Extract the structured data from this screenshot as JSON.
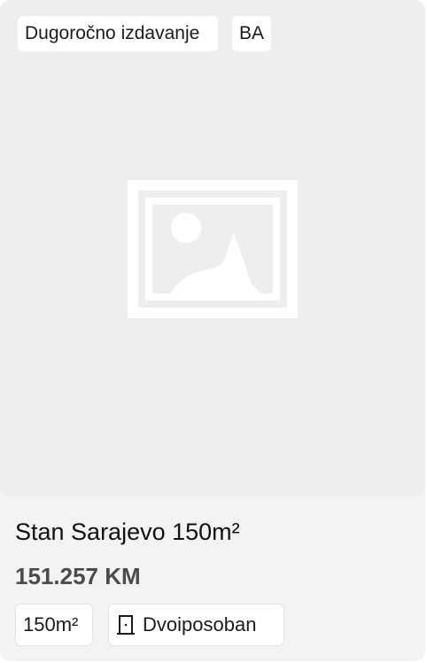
{
  "listing": {
    "listing_type_tag": "Dugoročno izdavanje",
    "country_tag": "BA",
    "image_icon": "image-placeholder-icon",
    "title": "Stan Sarajevo 150m²",
    "price": "151.257 KM",
    "area_chip": "150m²",
    "rooms_icon": "door-icon",
    "rooms_chip": "Dvoiposoban"
  }
}
